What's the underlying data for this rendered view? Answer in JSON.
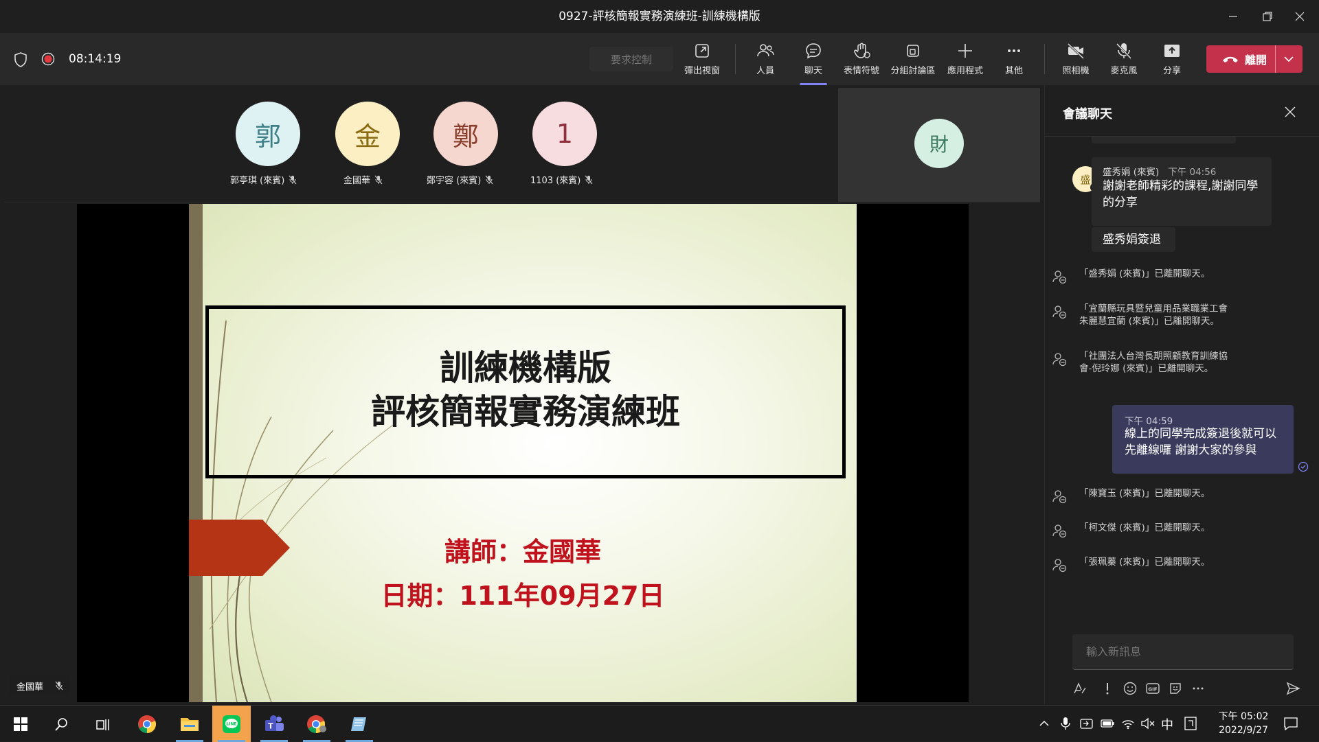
{
  "window": {
    "title": "0927-評核簡報實務演練班-訓練機構版"
  },
  "meeting": {
    "timer": "08:14:19"
  },
  "toolbar": {
    "request_control": "要求控制",
    "popout": "彈出視窗",
    "people": "人員",
    "chat": "聊天",
    "reactions": "表情符號",
    "breakout": "分組討論區",
    "apps": "應用程式",
    "more": "其他",
    "camera": "照相機",
    "mic": "麥克風",
    "share": "分享",
    "leave": "離開"
  },
  "participants": [
    {
      "initial": "郭",
      "name": "郭亭琪 (來賓)",
      "color": "#dff2f3",
      "text_color": "#3d7f86"
    },
    {
      "initial": "金",
      "name": "金國華",
      "color": "#fbefc3",
      "text_color": "#8a6b12"
    },
    {
      "initial": "鄭",
      "name": "鄭宇容 (來賓)",
      "color": "#f5d7cf",
      "text_color": "#8a3e2c"
    },
    {
      "initial": "1",
      "name": "1103 (來賓)",
      "color": "#f8dde0",
      "text_color": "#8f2e3d"
    }
  ],
  "side_tile": {
    "initial": "財"
  },
  "presenter_label": "金國華",
  "slide": {
    "title_line1": "訓練機構版",
    "title_line2": "評核簡報實務演練班",
    "lecturer": "講師：金國華",
    "date": "日期：111年09月27日"
  },
  "chat": {
    "header": "會議聊天",
    "msg1": {
      "avatar": "盛",
      "sender": "盛秀娟 (來賓)",
      "time": "下午 04:56",
      "text": "謝謝老師精彩的課程,謝謝同學的分享",
      "followup": "盛秀娟簽退"
    },
    "sys1": "「盛秀娟 (來賓)」已離開聊天。",
    "sys2": "「宜蘭縣玩具暨兒童用品業職業工會 朱麗慧宜蘭 (來賓)」已離開聊天。",
    "sys3": "「社團法人台灣長期照顧教育訓練協會-倪玲娜 (來賓)」已離開聊天。",
    "mine": {
      "time": "下午 04:59",
      "text": "線上的同學完成簽退後就可以先離線囉 謝謝大家的參與"
    },
    "sys4": "「陳寶玉 (來賓)」已離開聊天。",
    "sys5": "「柯文傑 (來賓)」已離開聊天。",
    "sys6": "「張珮蓁 (來賓)」已離開聊天。",
    "input_placeholder": "輸入新訊息"
  },
  "taskbar": {
    "ime": "中",
    "time": "下午 05:02",
    "date": "2022/9/27"
  },
  "colors": {
    "leave": "#c4314b",
    "accent": "#6264a7",
    "slide_red": "#c0121d"
  }
}
